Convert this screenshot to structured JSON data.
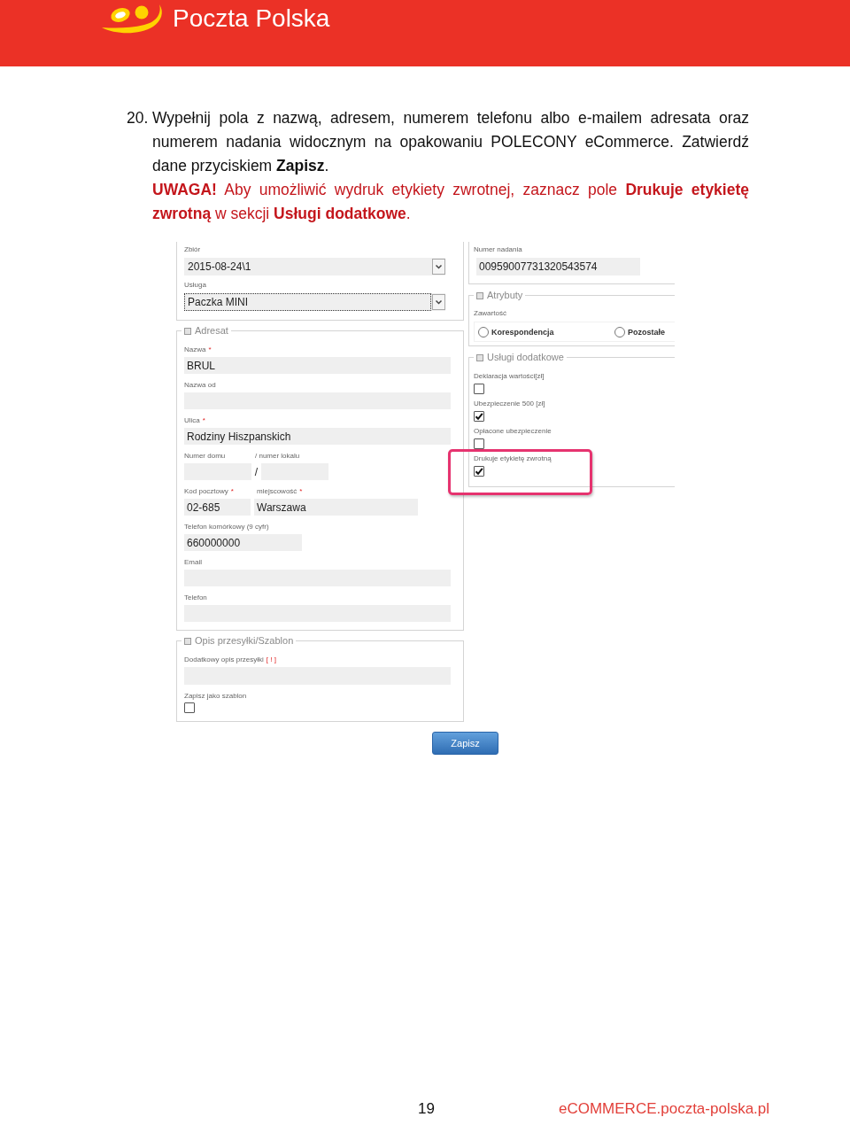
{
  "header": {
    "brand": "Poczta Polska"
  },
  "instruction": {
    "number": "20.",
    "text": "Wypełnij pola z nazwą, adresem, numerem telefonu albo e-mailem adresata oraz numerem nadania widocznym na opakowaniu POLECONY eCommerce. Zatwierdź dane przyciskiem **Zapisz**.",
    "warning": "**UWAGA!** Aby umożliwić wydruk etykiety zwrotnej, zaznacz pole **Drukuje etykietę zwrotną** w sekcji **Usługi dodatkowe**."
  },
  "form": {
    "shipment": [
      {
        "label": "Zbiór",
        "value": "2015-08-24\\1",
        "focused": false
      },
      {
        "label": "Usługa",
        "value": "Paczka MINI",
        "focused": true
      }
    ],
    "tracking": {
      "label": "Numer nadania",
      "value": "00959007731320543574"
    },
    "addressee": {
      "title": "Adresat",
      "rows": [
        {
          "fields": [
            {
              "kind": "text",
              "label": "Nazwa",
              "mark": "*",
              "value": "BRUL"
            }
          ]
        },
        {
          "fields": [
            {
              "kind": "text",
              "label": "Nazwa od"
            }
          ]
        },
        {
          "fields": [
            {
              "kind": "text",
              "label": "Ulica",
              "mark": "*",
              "value": "Rodziny Hiszpanskich"
            }
          ]
        },
        {
          "separator": "/",
          "fields": [
            {
              "kind": "house",
              "label": "Numer domu"
            },
            {
              "kind": "flat",
              "label": "/ numer lokalu"
            }
          ]
        },
        {
          "fields": [
            {
              "kind": "postcode",
              "label": "Kod pocztowy",
              "mark": "*",
              "value": "02-685"
            },
            {
              "kind": "city",
              "label": "miejscowość",
              "mark": "*",
              "value": "Warszawa"
            }
          ]
        },
        {
          "fields": [
            {
              "kind": "mobile",
              "label": "Telefon komórkowy (9 cyfr)",
              "value": "660000000"
            }
          ]
        },
        {
          "fields": [
            {
              "kind": "text",
              "label": "Email"
            }
          ]
        },
        {
          "fields": [
            {
              "kind": "text",
              "label": "Telefon"
            }
          ]
        }
      ]
    },
    "attributes": {
      "title": "Atrybuty",
      "label": "Zawartość",
      "options": [
        {
          "label": "Korespondencja",
          "selected": false
        },
        {
          "label": "Pozostałe",
          "selected": false
        }
      ]
    },
    "services": {
      "title": "Usługi dodatkowe",
      "items": [
        {
          "label": "Deklaracja wartości[zł]",
          "checked": false,
          "highlighted": false
        },
        {
          "label": "Ubezpieczenie 500 [zł]",
          "checked": true,
          "highlighted": false
        },
        {
          "label": "Opłacone ubezpieczenie",
          "checked": false,
          "highlighted": false
        },
        {
          "label": "Drukuje etykietę zwrotną",
          "checked": true,
          "highlighted": true
        }
      ]
    },
    "description": {
      "title": "Opis przesyłki/Szablon",
      "note": {
        "label": "Dodatkowy opis przesyłki",
        "mark": "[ ! ]"
      },
      "template": {
        "label": "Zapisz jako szablon",
        "checked": false
      }
    },
    "save": {
      "label": "Zapisz"
    }
  },
  "footer": {
    "page": "19",
    "url": "eCOMMERCE.poczta-polska.pl"
  }
}
